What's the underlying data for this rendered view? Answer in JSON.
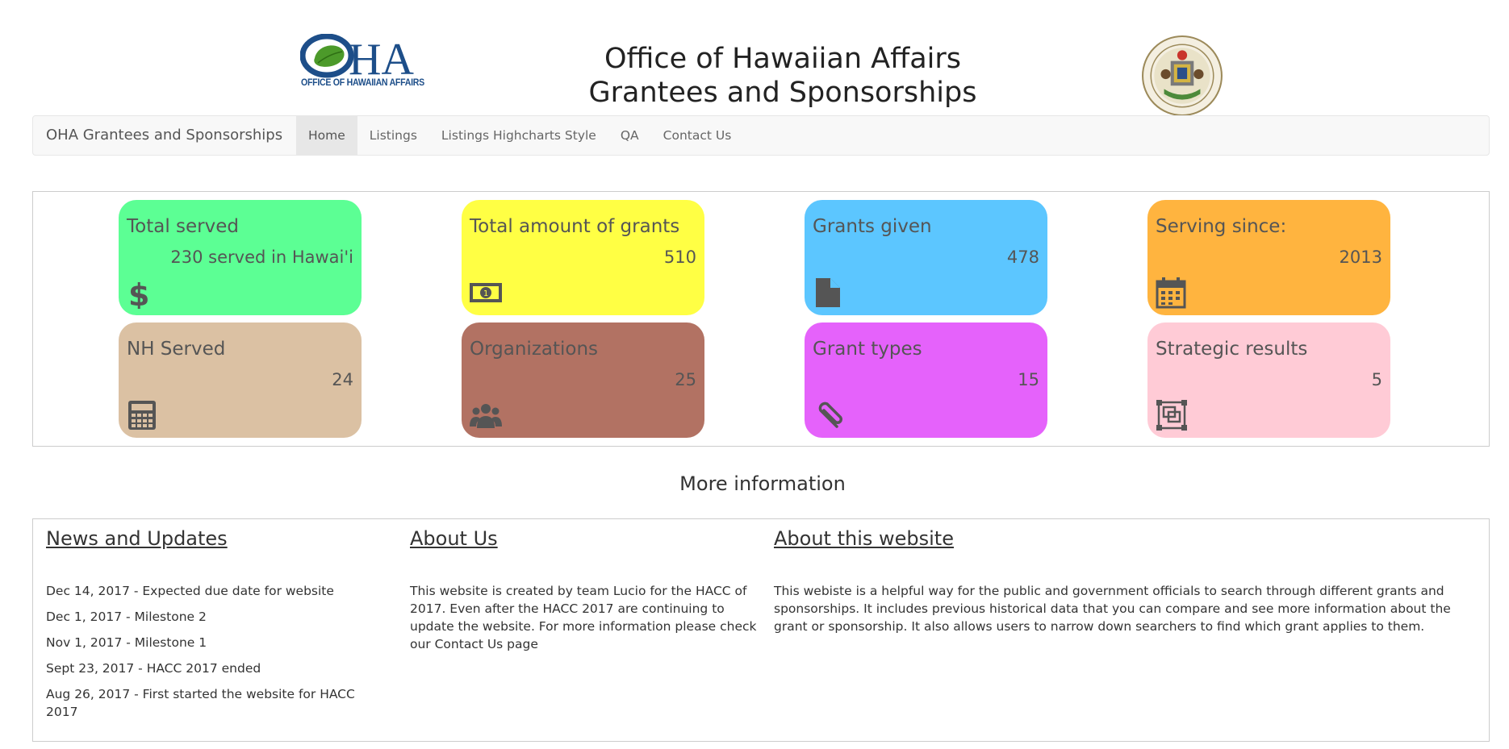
{
  "header": {
    "logo_text": "OHA",
    "logo_subtext": "OFFICE OF HAWAIIAN AFFAIRS",
    "title_line1": "Office of Hawaiian Affairs",
    "title_line2": "Grantees and Sponsorships",
    "seal_name": "state-of-hawaii-seal"
  },
  "navbar": {
    "brand": "OHA Grantees and Sponsorships",
    "items": [
      {
        "label": "Home",
        "active": true
      },
      {
        "label": "Listings",
        "active": false
      },
      {
        "label": "Listings Highcharts Style",
        "active": false
      },
      {
        "label": "QA",
        "active": false
      },
      {
        "label": "Contact Us",
        "active": false
      }
    ]
  },
  "stats": [
    {
      "title": "Total served",
      "value": "230 served in Hawai'i",
      "icon": "dollar-icon",
      "color": "#5cff94"
    },
    {
      "title": "Total amount of grants",
      "value": "510",
      "icon": "money-bill-icon",
      "color": "#ffff44"
    },
    {
      "title": "Grants given",
      "value": "478",
      "icon": "file-icon",
      "color": "#5cc6ff"
    },
    {
      "title": "Serving since:",
      "value": "2013",
      "icon": "calendar-icon",
      "color": "#ffb43f"
    },
    {
      "title": "NH Served",
      "value": "24",
      "icon": "calculator-icon",
      "color": "#dbc1a3"
    },
    {
      "title": "Organizations",
      "value": "25",
      "icon": "users-icon",
      "color": "#b27263"
    },
    {
      "title": "Grant types",
      "value": "15",
      "icon": "paperclip-icon",
      "color": "#e562fb"
    },
    {
      "title": "Strategic results",
      "value": "5",
      "icon": "object-group-icon",
      "color": "#ffcbd6"
    }
  ],
  "more_info_title": "More information",
  "news": {
    "heading": "News and Updates",
    "items": [
      "Dec 14, 2017 - Expected due date for website",
      "Dec 1, 2017 - Milestone 2",
      "Nov 1, 2017 - Milestone 1",
      "Sept 23, 2017 - HACC 2017 ended",
      "Aug 26, 2017 - First started the website for HACC 2017"
    ]
  },
  "about_us": {
    "heading": "About Us",
    "text": "This website is created by team Lucio for the HACC of 2017. Even after the HACC 2017 are continuing to update the website. For more information please check our Contact Us page"
  },
  "about_site": {
    "heading": "About this website",
    "text": "This webiste is a helpful way for the public and government officials to search through different grants and sponsorships. It includes previous historical data that you can compare and see more information about the grant or sponsorship. It also allows users to narrow down searchers to find which grant applies to them."
  }
}
